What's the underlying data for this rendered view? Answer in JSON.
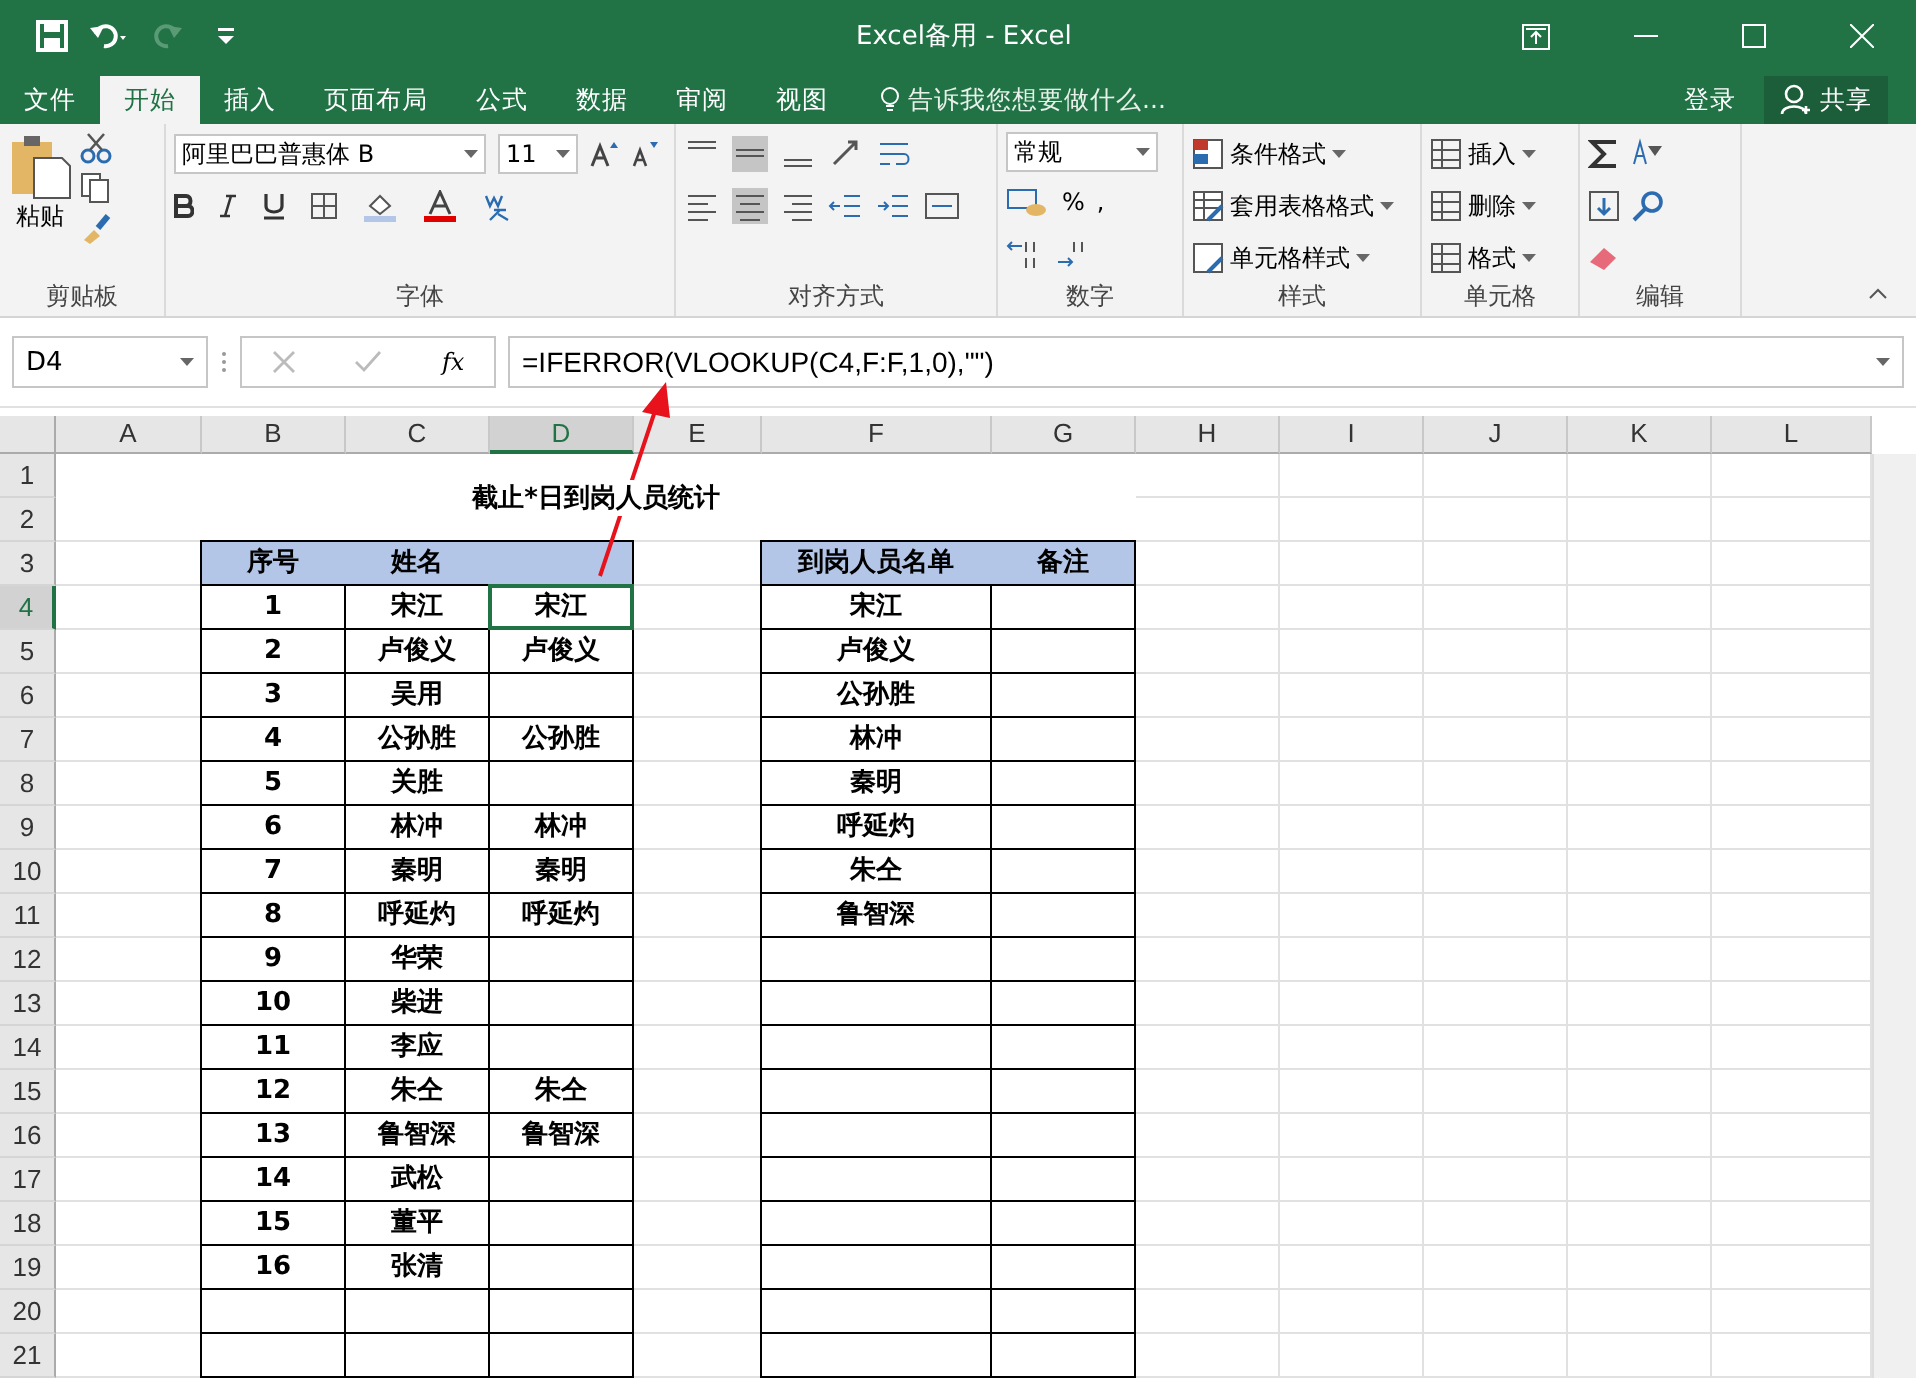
{
  "window": {
    "title": "Excel备用 - Excel"
  },
  "tabs": [
    {
      "label": "文件",
      "selected": false
    },
    {
      "label": "开始",
      "selected": true
    },
    {
      "label": "插入",
      "selected": false
    },
    {
      "label": "页面布局",
      "selected": false
    },
    {
      "label": "公式",
      "selected": false
    },
    {
      "label": "数据",
      "selected": false
    },
    {
      "label": "审阅",
      "selected": false
    },
    {
      "label": "视图",
      "selected": false
    }
  ],
  "tell_me": {
    "placeholder": "告诉我您想要做什么..."
  },
  "sign_in": "登录",
  "share": "共享",
  "ribbon": {
    "paste": "粘贴",
    "font_name": "阿里巴巴普惠体 B",
    "font_size": "11",
    "number_format": "常规",
    "percent": "%",
    "comma": ",",
    "styles": [
      "条件格式",
      "套用表格格式",
      "单元格样式"
    ],
    "cells": [
      "插入",
      "删除",
      "格式"
    ],
    "groups": [
      "剪贴板",
      "字体",
      "对齐方式",
      "数字",
      "样式",
      "单元格",
      "编辑"
    ]
  },
  "formula_bar": {
    "name_box": "D4",
    "fx": "fx",
    "formula": "=IFERROR(VLOOKUP(C4,F:F,1,0),\"\")"
  },
  "columns": [
    {
      "label": "A",
      "selected": false
    },
    {
      "label": "B",
      "selected": false
    },
    {
      "label": "C",
      "selected": false
    },
    {
      "label": "D",
      "selected": true
    },
    {
      "label": "E",
      "selected": false
    },
    {
      "label": "F",
      "selected": false
    },
    {
      "label": "G",
      "selected": false
    },
    {
      "label": "H",
      "selected": false
    },
    {
      "label": "I",
      "selected": false
    },
    {
      "label": "J",
      "selected": false
    },
    {
      "label": "K",
      "selected": false
    },
    {
      "label": "L",
      "selected": false
    }
  ],
  "row_headers": [
    {
      "label": "1",
      "selected": false
    },
    {
      "label": "2",
      "selected": false
    },
    {
      "label": "3",
      "selected": false
    },
    {
      "label": "4",
      "selected": true
    },
    {
      "label": "5",
      "selected": false
    },
    {
      "label": "6",
      "selected": false
    },
    {
      "label": "7",
      "selected": false
    },
    {
      "label": "8",
      "selected": false
    },
    {
      "label": "9",
      "selected": false
    },
    {
      "label": "10",
      "selected": false
    },
    {
      "label": "11",
      "selected": false
    },
    {
      "label": "12",
      "selected": false
    },
    {
      "label": "13",
      "selected": false
    },
    {
      "label": "14",
      "selected": false
    },
    {
      "label": "15",
      "selected": false
    },
    {
      "label": "16",
      "selected": false
    },
    {
      "label": "17",
      "selected": false
    },
    {
      "label": "18",
      "selected": false
    },
    {
      "label": "19",
      "selected": false
    },
    {
      "label": "20",
      "selected": false
    },
    {
      "label": "21",
      "selected": false
    }
  ],
  "title": "截止*日到岗人员统计",
  "left_table": {
    "headers": [
      "序号",
      "姓名"
    ],
    "rows": [
      {
        "number": "1",
        "name": "宋江",
        "result": "宋江",
        "selected": true
      },
      {
        "number": "2",
        "name": "卢俊义",
        "result": "卢俊义",
        "selected": false
      },
      {
        "number": "3",
        "name": "吴用",
        "selected": false
      },
      {
        "number": "4",
        "name": "公孙胜",
        "result": "公孙胜",
        "selected": false
      },
      {
        "number": "5",
        "name": "关胜",
        "selected": false
      },
      {
        "number": "6",
        "name": "林冲",
        "result": "林冲",
        "selected": false
      },
      {
        "number": "7",
        "name": "秦明",
        "result": "秦明",
        "selected": false
      },
      {
        "number": "8",
        "name": "呼延灼",
        "result": "呼延灼",
        "selected": false
      },
      {
        "number": "9",
        "name": "华荣",
        "selected": false
      },
      {
        "number": "10",
        "name": "柴进",
        "selected": false
      },
      {
        "number": "11",
        "name": "李应",
        "selected": false
      },
      {
        "number": "12",
        "name": "朱仝",
        "result": "朱仝",
        "selected": false
      },
      {
        "number": "13",
        "name": "鲁智深",
        "result": "鲁智深",
        "selected": false
      },
      {
        "number": "14",
        "name": "武松",
        "selected": false
      },
      {
        "number": "15",
        "name": "董平",
        "selected": false
      },
      {
        "number": "16",
        "name": "张清",
        "selected": false
      }
    ]
  },
  "right_table": {
    "headers": [
      "到岗人员名单",
      "备注"
    ],
    "rows": [
      {
        "name": "宋江"
      },
      {
        "name": "卢俊义"
      },
      {
        "name": "公孙胜"
      },
      {
        "name": "林冲"
      },
      {
        "name": "秦明"
      },
      {
        "name": "呼延灼"
      },
      {
        "name": "朱仝"
      },
      {
        "name": "鲁智深"
      }
    ]
  },
  "annotations": [
    {
      "kind": "arrow"
    }
  ]
}
